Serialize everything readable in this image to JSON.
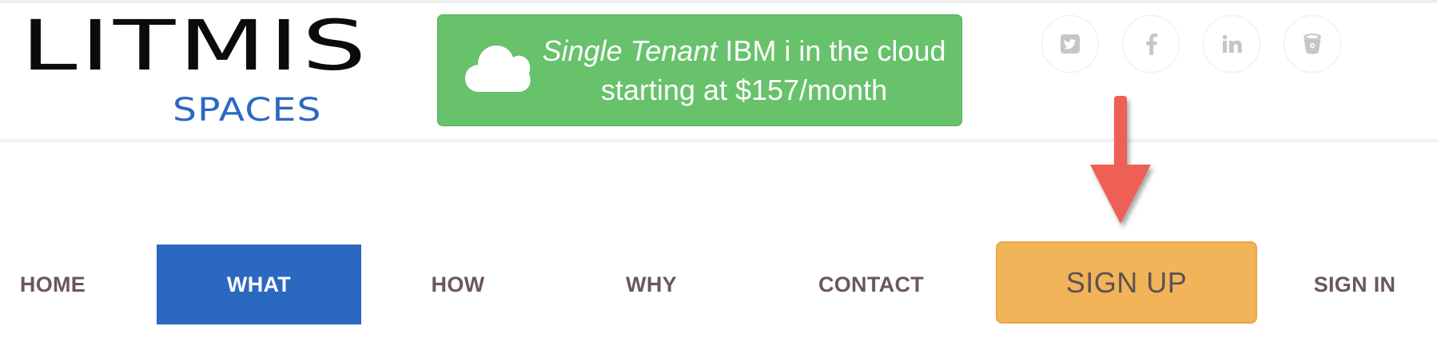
{
  "logo": {
    "main": "LITMIS",
    "sub": "SPACES"
  },
  "promo": {
    "icon": "cloud-icon",
    "emphasis": "Single Tenant",
    "line1_rest": " IBM i in the cloud",
    "line2": "starting at $157/month",
    "color": "#67c26b"
  },
  "social": [
    {
      "name": "twitter",
      "icon": "twitter-icon"
    },
    {
      "name": "facebook",
      "icon": "facebook-icon"
    },
    {
      "name": "linkedin",
      "icon": "linkedin-icon"
    },
    {
      "name": "bucket",
      "icon": "bucket-icon"
    }
  ],
  "nav": {
    "home": "HOME",
    "what": "WHAT",
    "how": "HOW",
    "why": "WHY",
    "contact": "CONTACT",
    "signup": "SIGN UP",
    "signin": "SIGN IN",
    "active_color": "#2a69bf",
    "signup_color": "#f1b458"
  },
  "annotation": {
    "icon": "arrow-down-icon",
    "color": "#ee6157"
  }
}
